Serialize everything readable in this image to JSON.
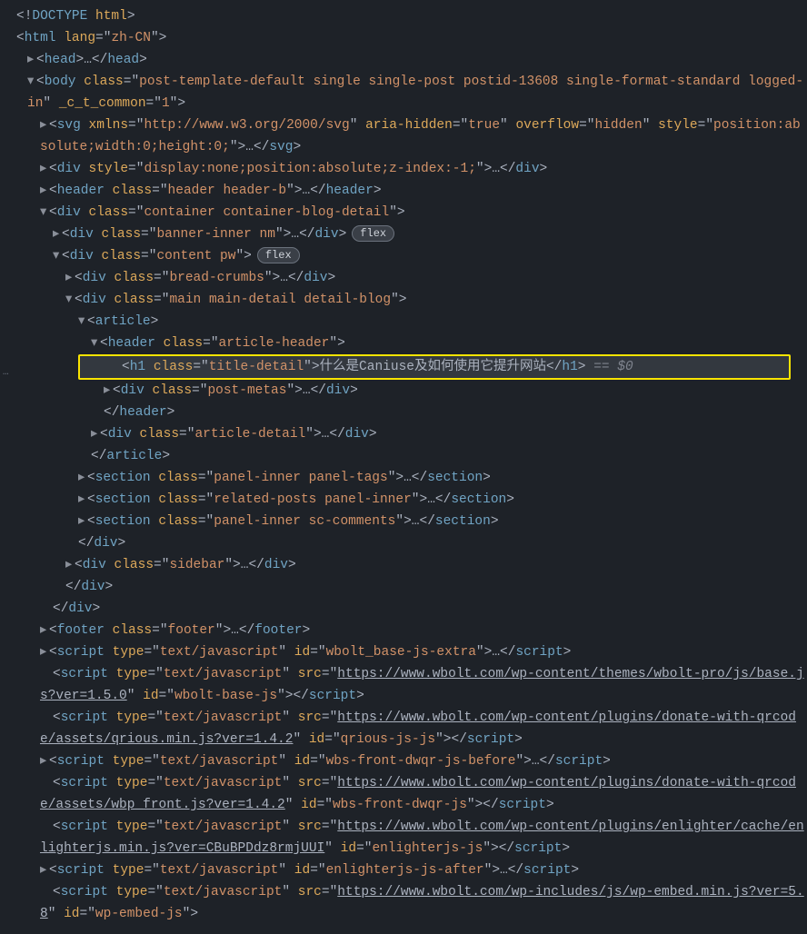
{
  "doctype": "<!DOCTYPE html>",
  "htmlLang": "zh-CN",
  "headEll": "…",
  "bodyClass": "post-template-default single single-post postid-13608 single-format-standard logged-in",
  "bodyAttrName": "_c_t_common",
  "bodyAttrVal": "1",
  "svg": {
    "xmlns": "http://www.w3.org/2000/svg",
    "ariaHidden": "true",
    "overflow": "hidden",
    "style": "position:absolute;width:0;height:0;"
  },
  "divHiddenStyle": "display:none;position:absolute;z-index:-1;",
  "headerClass": "header header-b",
  "containerClass": "container container-blog-detail",
  "bannerInnerClass": "banner-inner nm",
  "contentClass": "content pw",
  "breadClass": "bread-crumbs",
  "mainClass": "main main-detail detail-blog",
  "articleHeaderClass": "article-header",
  "h1Class": "title-detail",
  "h1Text": "什么是Caniuse及如何使用它提升网站",
  "selectedSuffix": " == $0",
  "postMetasClass": "post-metas",
  "articleDetailClass": "article-detail",
  "section1": "panel-inner panel-tags",
  "section2": "related-posts panel-inner",
  "section3": "panel-inner sc-comments",
  "sidebarClass": "sidebar",
  "footerClass": "footer",
  "flexBadge": "flex",
  "scripts": {
    "type": "text/javascript",
    "s1id": "wbolt_base-js-extra",
    "s2src": "https://www.wbolt.com/wp-content/themes/wbolt-pro/js/base.js?ver=1.5.0",
    "s2id": "wbolt-base-js",
    "s3src": "https://www.wbolt.com/wp-content/plugins/donate-with-qrcode/assets/qrious.min.js?ver=1.4.2",
    "s3id": "qrious-js-js",
    "s4id": "wbs-front-dwqr-js-before",
    "s5src": "https://www.wbolt.com/wp-content/plugins/donate-with-qrcode/assets/wbp_front.js?ver=1.4.2",
    "s5id": "wbs-front-dwqr-js",
    "s6src": "https://www.wbolt.com/wp-content/plugins/enlighter/cache/enlighterjs.min.js?ver=CBuBPDdz8rmjUUI",
    "s6id": "enlighterjs-js",
    "s7id": "enlighterjs-js-after",
    "s8src": "https://www.wbolt.com/wp-includes/js/wp-embed.min.js?ver=5.8",
    "s8id": "wp-embed-js"
  },
  "gutterDots": "…"
}
